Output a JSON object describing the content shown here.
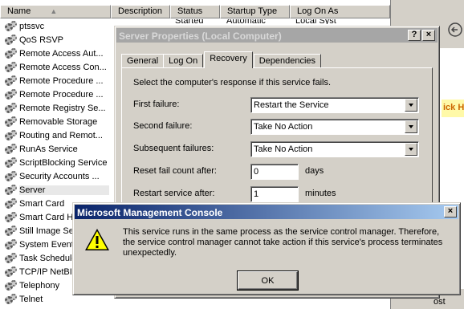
{
  "services_window": {
    "columns": [
      "Name",
      "Description",
      "Status",
      "Startup Type",
      "Log On As"
    ],
    "top_fragments": [
      "Started",
      "Automatic",
      "Local Syst"
    ],
    "services": [
      "ptssvc",
      "QoS RSVP",
      "Remote Access Aut...",
      "Remote Access Con...",
      "Remote Procedure ...",
      "Remote Procedure ...",
      "Remote Registry Se...",
      "Removable Storage",
      "Routing and Remot...",
      "RunAs Service",
      "ScriptBlocking Service",
      "Security Accounts ...",
      "Server",
      "Smart Card",
      "Smart Card He",
      "Still Image Ser",
      "System Event",
      "Task Schedule",
      "TCP/IP NetBIO",
      "Telephony",
      "Telnet"
    ],
    "selected_service": "Server"
  },
  "right_strip": {
    "highlight_text": "ick H",
    "bottom_text": "ost"
  },
  "properties_dialog": {
    "title": "Server Properties (Local Computer)",
    "help_btn": "?",
    "close_btn": "×",
    "tabs": [
      "General",
      "Log On",
      "Recovery",
      "Dependencies"
    ],
    "active_tab": "Recovery",
    "intro": "Select the computer's response if this service fails.",
    "fields": {
      "first_failure": {
        "label": "First failure:",
        "value": "Restart the Service"
      },
      "second_failure": {
        "label": "Second failure:",
        "value": "Take No Action"
      },
      "subsequent_failures": {
        "label": "Subsequent failures:",
        "value": "Take No Action"
      },
      "reset_count": {
        "label": "Reset fail count after:",
        "value": "0",
        "unit": "days"
      },
      "restart_after": {
        "label": "Restart service after:",
        "value": "1",
        "unit": "minutes"
      }
    }
  },
  "message_box": {
    "title": "Microsoft Management Console",
    "close_btn": "×",
    "icon": "warning-icon",
    "text": "This service runs in the same process as the service control manager. Therefore, the service control manager cannot take action if this service's process terminates unexpectedly.",
    "ok_label": "OK"
  },
  "colors": {
    "active_title_start": "#0a246a",
    "active_title_end": "#a6caf0",
    "inactive_title": "#a6a6a6",
    "face": "#d4d0c8",
    "warning_yellow": "#ffff00"
  }
}
